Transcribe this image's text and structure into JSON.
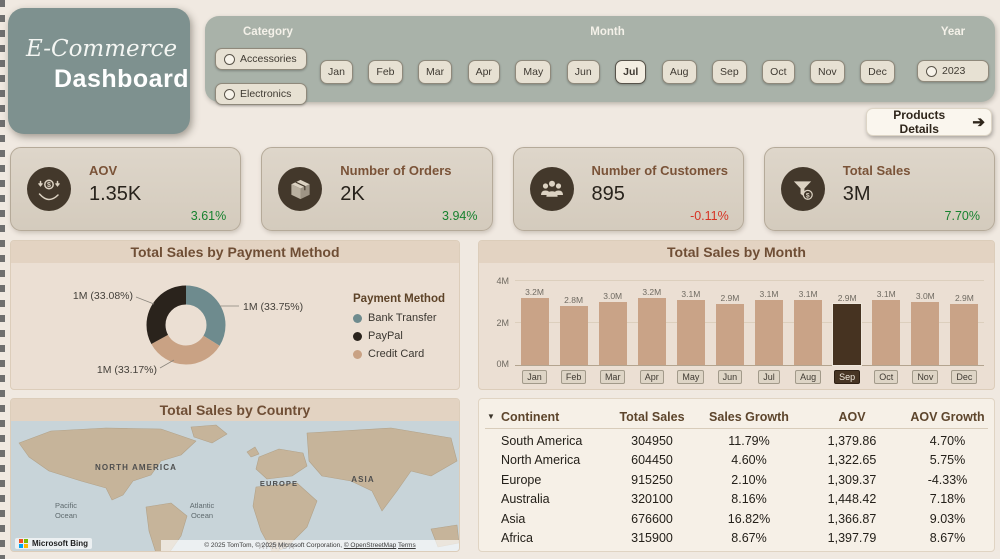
{
  "icons": {
    "table_dropdown": "▼",
    "products_arrow": "➔"
  },
  "header": {
    "title_line1": "E-Commerce",
    "title_line2": "Dashboard"
  },
  "filters": {
    "category": {
      "label": "Category",
      "options": [
        "Accessories",
        "Electronics"
      ]
    },
    "month": {
      "label": "Month",
      "options": [
        "Jan",
        "Feb",
        "Mar",
        "Apr",
        "May",
        "Jun",
        "Jul",
        "Aug",
        "Sep",
        "Oct",
        "Nov",
        "Dec"
      ],
      "selected": "Jul"
    },
    "year": {
      "label": "Year",
      "options": [
        "2023"
      ]
    },
    "products_button": "Products Details"
  },
  "kpis": [
    {
      "icon": "hand-dollar-icon",
      "label": "AOV",
      "value": "1.35K",
      "delta": "3.61%",
      "trend": "up"
    },
    {
      "icon": "package-icon",
      "label": "Number of Orders",
      "value": "2K",
      "delta": "3.94%",
      "trend": "up"
    },
    {
      "icon": "customers-icon",
      "label": "Number of Customers",
      "value": "895",
      "delta": "-0.11%",
      "trend": "down"
    },
    {
      "icon": "funnel-dollar-icon",
      "label": "Total Sales",
      "value": "3M",
      "delta": "7.70%",
      "trend": "up"
    }
  ],
  "colors": {
    "delta_up": "#17822f",
    "delta_down": "#d63324",
    "bar": "#c9a387",
    "bar_highlight": "#463321"
  },
  "map": {
    "title": "Total Sales by Country",
    "labels": {
      "north_america": "NORTH AMERICA",
      "europe": "EUROPE",
      "asia": "ASIA",
      "africa": "AFRICA",
      "pacific1": "Pacific",
      "pacific2": "Ocean",
      "atlantic1": "Atlantic",
      "atlantic2": "Ocean"
    },
    "bing": "Microsoft Bing",
    "attribution1": "© 2025 TomTom, © 2025 Microsoft Corporation,",
    "attribution2": "© OpenStreetMap",
    "terms": "Terms"
  },
  "chart_data": [
    {
      "type": "pie",
      "donut": true,
      "title": "Total Sales by Payment Method",
      "legend_title": "Payment Method",
      "segments": [
        {
          "name": "Bank Transfer",
          "value_label": "1M (33.75%)",
          "pct": 33.75,
          "color": "#6e8b8e"
        },
        {
          "name": "PayPal",
          "value_label": "1M (33.08%)",
          "pct": 33.08,
          "color": "#2a231c"
        },
        {
          "name": "Credit Card",
          "value_label": "1M (33.17%)",
          "pct": 33.17,
          "color": "#c9a284"
        }
      ],
      "draw_order": [
        0,
        2,
        1
      ]
    },
    {
      "type": "bar",
      "title": "Total Sales by Month",
      "categories": [
        "Jan",
        "Feb",
        "Mar",
        "Apr",
        "May",
        "Jun",
        "Jul",
        "Aug",
        "Sep",
        "Oct",
        "Nov",
        "Dec"
      ],
      "values": [
        3.2,
        2.8,
        3.0,
        3.2,
        3.1,
        2.9,
        3.1,
        3.1,
        2.9,
        3.1,
        3.0,
        2.9
      ],
      "value_labels": [
        "3.2M",
        "2.8M",
        "3.0M",
        "3.2M",
        "3.1M",
        "2.9M",
        "3.1M",
        "3.1M",
        "2.9M",
        "3.1M",
        "3.0M",
        "2.9M"
      ],
      "ylim": [
        0,
        4
      ],
      "yticks": [
        "0M",
        "2M",
        "4M"
      ],
      "highlight_index": 8,
      "highlight_category": "Sep"
    },
    {
      "type": "table",
      "columns": [
        "Continent",
        "Total Sales",
        "Sales Growth",
        "AOV",
        "AOV Growth"
      ],
      "rows": [
        [
          "South America",
          "304950",
          "11.79%",
          "1,379.86",
          "4.70%"
        ],
        [
          "North America",
          "604450",
          "4.60%",
          "1,322.65",
          "5.75%"
        ],
        [
          "Europe",
          "915250",
          "2.10%",
          "1,309.37",
          "-4.33%"
        ],
        [
          "Australia",
          "320100",
          "8.16%",
          "1,448.42",
          "7.18%"
        ],
        [
          "Asia",
          "676600",
          "16.82%",
          "1,366.87",
          "9.03%"
        ],
        [
          "Africa",
          "315900",
          "8.67%",
          "1,397.79",
          "8.67%"
        ]
      ]
    }
  ]
}
